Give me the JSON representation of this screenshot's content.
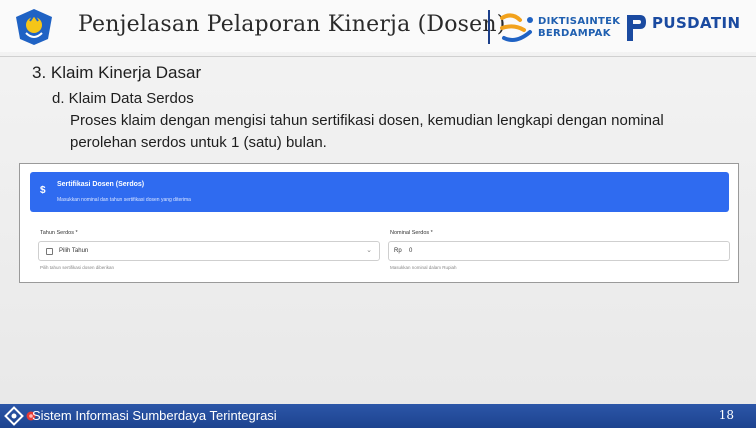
{
  "header": {
    "title": "Penjelasan Pelaporan Kinerja (Dosen)",
    "left_logo": "tut-wuri-handayani-logo",
    "dikti": {
      "line1": "DIKTISAINTEK",
      "line2": "BERDAMPAK"
    },
    "pusdatin": {
      "name": "PUSDATIN"
    },
    "colors": {
      "brand_blue": "#1a4aa0",
      "accent_orange": "#f2a21c"
    }
  },
  "content": {
    "section_title": "3. Klaim Kinerja Dasar",
    "sub_title": "d. Klaim Data Serdos",
    "description": "Proses klaim dengan mengisi tahun sertifikasi dosen, kemudian lengkapi dengan nominal perolehan serdos untuk 1 (satu) bulan."
  },
  "form": {
    "banner_icon": "$",
    "banner_title": "Sertifikasi Dosen (Serdos)",
    "banner_subtitle": "Masukkan nominal dan tahun sertifikasi dosen yang diterima",
    "banner_color": "#2f6bf0",
    "year_field": {
      "label": "Tahun Serdos *",
      "value": "Pilih Tahun",
      "help": "Pilih tahun sertifikasi dosen diberikan"
    },
    "nominal_field": {
      "label": "Nominal Serdos *",
      "prefix": "Rp",
      "value": "0",
      "help": "Masukkan nominal dalam Rupiah"
    }
  },
  "footer": {
    "text": "Sistem Informasi Sumberdaya Terintegrasi",
    "page_number": "18",
    "color": "#2c56a8"
  }
}
